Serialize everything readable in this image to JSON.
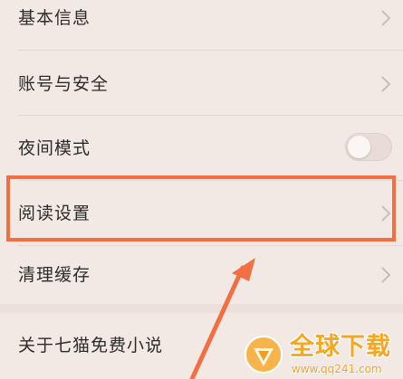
{
  "settings": {
    "items": [
      {
        "label": "基本信息",
        "control": "chevron"
      },
      {
        "label": "账号与安全",
        "control": "chevron"
      },
      {
        "label": "夜间模式",
        "control": "toggle",
        "toggle_on": false
      },
      {
        "label": "阅读设置",
        "control": "chevron",
        "highlighted": true
      },
      {
        "label": "清理缓存",
        "control": "chevron"
      },
      {
        "label": "关于七猫免费小说",
        "control": "chevron"
      }
    ]
  },
  "annotation": {
    "highlight_color": "#f26f43",
    "arrow_color": "#f26f43",
    "arrow_icon": "arrow-up-right-icon"
  },
  "watermark": {
    "text": "全球下载",
    "url": "www.qq241.com",
    "color": "#f5a623",
    "logo_icon": "globe-logo-icon"
  }
}
